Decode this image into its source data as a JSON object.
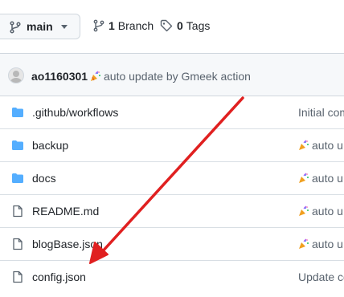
{
  "branch_selector": {
    "label": "main"
  },
  "branch_count": {
    "count": "1",
    "label": "Branch"
  },
  "tag_count": {
    "count": "0",
    "label": "Tags"
  },
  "latest_commit": {
    "author": "ao1160301",
    "message": "auto update by Gmeek action",
    "emoji_icon": "party-popper-icon"
  },
  "files": [
    {
      "name": ".github/workflows",
      "type": "folder",
      "commit_message": "Initial com",
      "emoji": false
    },
    {
      "name": "backup",
      "type": "folder",
      "commit_message": "auto u",
      "emoji": true
    },
    {
      "name": "docs",
      "type": "folder",
      "commit_message": "auto u",
      "emoji": true
    },
    {
      "name": "README.md",
      "type": "file",
      "commit_message": "auto u",
      "emoji": true
    },
    {
      "name": "blogBase.json",
      "type": "file",
      "commit_message": "auto u",
      "emoji": true
    },
    {
      "name": "config.json",
      "type": "file",
      "commit_message": "Update co",
      "emoji": false
    }
  ],
  "colors": {
    "folder": "#54aeff",
    "arrow": "#e02020",
    "border": "#d0d7de",
    "muted_text": "#59636e"
  }
}
